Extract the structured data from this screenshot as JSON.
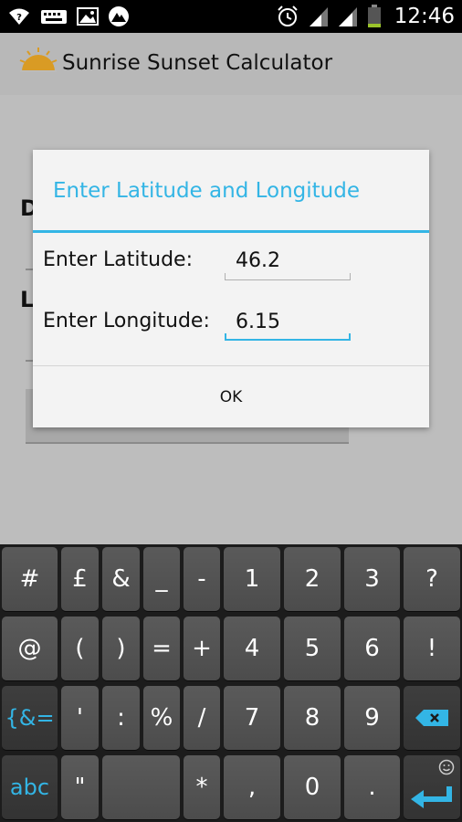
{
  "status_bar": {
    "time": "12:46",
    "icons": [
      "wifi-icon",
      "keyboard-icon",
      "gallery-icon",
      "app-icon",
      "alarm-icon",
      "signal-icon",
      "signal-icon",
      "battery-icon"
    ]
  },
  "app_bar": {
    "title": "Sunrise Sunset Calculator",
    "icon": "sun-icon"
  },
  "dialog": {
    "title": "Enter Latitude and Longitude",
    "latitude_label": "Enter Latitude:",
    "latitude_value": "46.2",
    "longitude_label": "Enter Longitude:",
    "longitude_value": "6.15",
    "ok_label": "OK"
  },
  "keyboard": {
    "row1": [
      "#",
      "£",
      "&",
      "_",
      "-",
      "1",
      "2",
      "3",
      "?"
    ],
    "row2": [
      "@",
      "(",
      ")",
      "=",
      "+",
      "4",
      "5",
      "6",
      "!"
    ],
    "row3": [
      "{&=",
      "'",
      ":",
      "%",
      "/",
      "7",
      "8",
      "9"
    ],
    "row4": [
      "abc",
      "\"",
      "*",
      ",",
      "0",
      "."
    ],
    "icons": [
      "backspace-icon",
      "enter-icon",
      "emoji-icon"
    ]
  },
  "colors": {
    "accent": "#33b5e5",
    "dialog_bg": "#f3f3f3",
    "keyboard_bg": "#1c1c1c"
  }
}
